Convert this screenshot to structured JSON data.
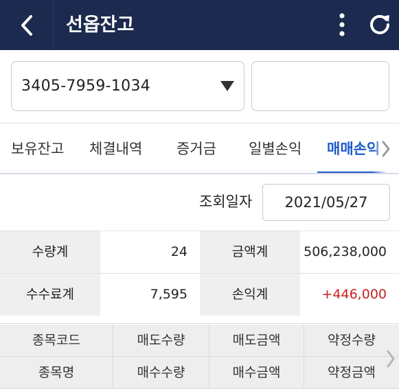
{
  "header": {
    "title": "선옵잔고",
    "back_icon": "chevron-left-icon",
    "more_icon": "vertical-dots-icon",
    "refresh_icon": "refresh-icon",
    "bg_color": "#1b2a4e"
  },
  "account": {
    "number": "3405-7959-1034",
    "dropdown_icon": "triangle-down-icon",
    "name": ""
  },
  "tabs": {
    "items": [
      {
        "label": "보유잔고",
        "active": false
      },
      {
        "label": "체결내역",
        "active": false
      },
      {
        "label": "증거금",
        "active": false
      },
      {
        "label": "일별손익",
        "active": false
      },
      {
        "label": "매매손익",
        "active": true
      }
    ],
    "active_color": "#1c5ac8",
    "scroll_icon": "chevron-right-icon"
  },
  "query": {
    "label": "조회일자",
    "date": "2021/05/27"
  },
  "summary": {
    "qty_total_label": "수량계",
    "qty_total_value": "24",
    "amount_total_label": "금액계",
    "amount_total_value": "506,238,000",
    "fee_total_label": "수수료계",
    "fee_total_value": "7,595",
    "pnl_total_label": "손익계",
    "pnl_total_value": "+446,000",
    "pnl_color": "#c8201e"
  },
  "columns": {
    "row1": [
      "종목코드",
      "매도수량",
      "매도금액",
      "약정수량"
    ],
    "row2": [
      "종목명",
      "매수수량",
      "매수금액",
      "약정금액"
    ],
    "scroll_icon": "chevron-right-icon"
  }
}
